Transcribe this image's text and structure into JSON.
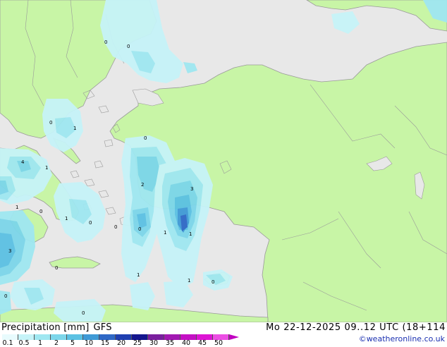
{
  "footer": {
    "product": "Precipitation [mm]",
    "model": "GFS",
    "datetime": "Mo 22-12-2025 09..12 UTC (18+114",
    "credit": "©weatheronline.co.uk"
  },
  "legend": {
    "values": [
      "0.1",
      "0.5",
      "1",
      "2",
      "5",
      "10",
      "15",
      "20",
      "25",
      "30",
      "35",
      "40",
      "45",
      "50"
    ],
    "colors": [
      "#e8fbfd",
      "#c6f3f8",
      "#9fe7f1",
      "#7cd6ea",
      "#5bc1e3",
      "#3f9ad6",
      "#2e68c6",
      "#1f3fb0",
      "#14168e",
      "#7a1f9e",
      "#a218b2",
      "#c410c4",
      "#dd14d4",
      "#ec4ee4"
    ]
  },
  "map_labels": [
    "0",
    "0",
    "0",
    "1",
    "4",
    "1",
    "1",
    "0",
    "0",
    "0",
    "2",
    "3",
    "1",
    "0",
    "0",
    "1",
    "1",
    "3",
    "0",
    "1",
    "1",
    "0",
    "0",
    "0"
  ],
  "colors": {
    "land": "#c8f5a6",
    "sea": "#e8e8e8",
    "border": "#9a9a9a"
  }
}
